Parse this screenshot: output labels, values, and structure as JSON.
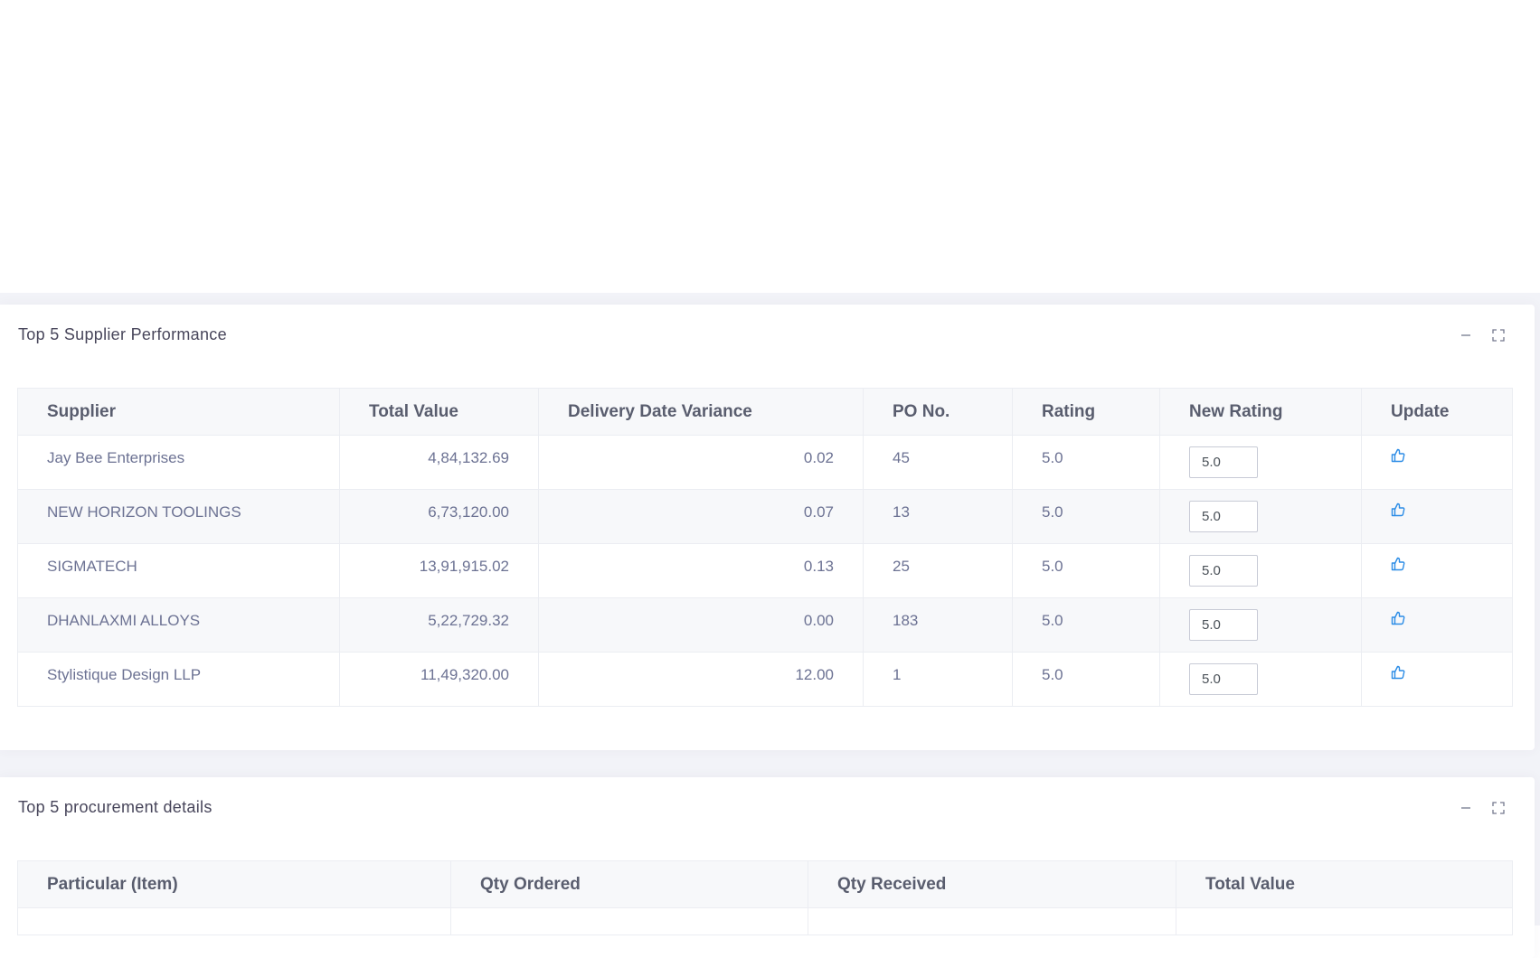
{
  "colors": {
    "page_background": "#f2f3f8",
    "card_background": "#ffffff",
    "header_background": "#f7f8fa",
    "accent_icon": "#2b8ce6"
  },
  "supplier_performance": {
    "title": "Top 5 Supplier Performance",
    "tools": [
      "minimize-icon",
      "fullscreen-icon"
    ],
    "columns": [
      "Supplier",
      "Total Value",
      "Delivery Date Variance",
      "PO No.",
      "Rating",
      "New Rating",
      "Update"
    ],
    "rows": [
      {
        "supplier": "Jay Bee Enterprises",
        "total_value": "4,84,132.69",
        "variance": "0.02",
        "po_no": "45",
        "rating": "5.0",
        "new_rating": "5.0",
        "update_icon": "thumbs-up-icon"
      },
      {
        "supplier": "NEW HORIZON TOOLINGS",
        "total_value": "6,73,120.00",
        "variance": "0.07",
        "po_no": "13",
        "rating": "5.0",
        "new_rating": "5.0",
        "update_icon": "thumbs-up-icon"
      },
      {
        "supplier": "SIGMATECH",
        "total_value": "13,91,915.02",
        "variance": "0.13",
        "po_no": "25",
        "rating": "5.0",
        "new_rating": "5.0",
        "update_icon": "thumbs-up-icon"
      },
      {
        "supplier": "DHANLAXMI ALLOYS",
        "total_value": "5,22,729.32",
        "variance": "0.00",
        "po_no": "183",
        "rating": "5.0",
        "new_rating": "5.0",
        "update_icon": "thumbs-up-icon"
      },
      {
        "supplier": "Stylistique Design LLP",
        "total_value": "11,49,320.00",
        "variance": "12.00",
        "po_no": "1",
        "rating": "5.0",
        "new_rating": "5.0",
        "update_icon": "thumbs-up-icon"
      }
    ]
  },
  "procurement_details": {
    "title": "Top 5 procurement details",
    "tools": [
      "minimize-icon",
      "fullscreen-icon"
    ],
    "columns": [
      "Particular (Item)",
      "Qty Ordered",
      "Qty Received",
      "Total Value"
    ]
  }
}
